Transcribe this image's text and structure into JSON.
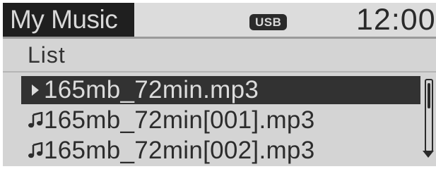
{
  "header": {
    "title": "My Music",
    "source_badge": "USB",
    "clock": "12:00"
  },
  "section": {
    "label": "List"
  },
  "list": {
    "items": [
      {
        "name": "165mb_72min.mp3",
        "icon": "play-icon",
        "selected": true
      },
      {
        "name": "165mb_72min[001].mp3",
        "icon": "music-note-icon",
        "selected": false
      },
      {
        "name": "165mb_72min[002].mp3",
        "icon": "music-note-icon",
        "selected": false
      }
    ]
  },
  "colors": {
    "screen_bg": "#d4d4d4",
    "title_bg": "#1f1f1f",
    "selected_bg": "#323232",
    "text_dark": "#2c2c2c",
    "text_light": "#dcdcdc"
  }
}
